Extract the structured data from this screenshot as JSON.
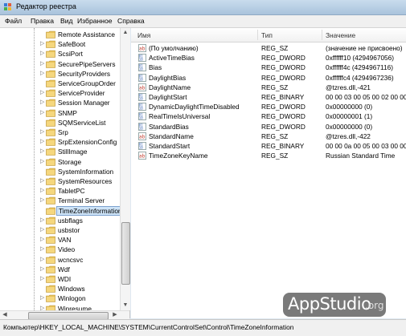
{
  "window": {
    "title": "Редактор реестра",
    "icon": "regedit-icon"
  },
  "menu": [
    "Файл",
    "Правка",
    "Вид",
    "Избранное",
    "Справка"
  ],
  "tree": {
    "items": [
      {
        "label": "Remote Assistance",
        "expandable": false,
        "selected": false
      },
      {
        "label": "SafeBoot",
        "expandable": true,
        "selected": false
      },
      {
        "label": "ScsiPort",
        "expandable": true,
        "selected": false
      },
      {
        "label": "SecurePipeServers",
        "expandable": true,
        "selected": false
      },
      {
        "label": "SecurityProviders",
        "expandable": true,
        "selected": false
      },
      {
        "label": "ServiceGroupOrder",
        "expandable": false,
        "selected": false
      },
      {
        "label": "ServiceProvider",
        "expandable": true,
        "selected": false
      },
      {
        "label": "Session Manager",
        "expandable": true,
        "selected": false
      },
      {
        "label": "SNMP",
        "expandable": true,
        "selected": false
      },
      {
        "label": "SQMServiceList",
        "expandable": false,
        "selected": false
      },
      {
        "label": "Srp",
        "expandable": true,
        "selected": false
      },
      {
        "label": "SrpExtensionConfig",
        "expandable": true,
        "selected": false
      },
      {
        "label": "StillImage",
        "expandable": true,
        "selected": false
      },
      {
        "label": "Storage",
        "expandable": true,
        "selected": false
      },
      {
        "label": "SystemInformation",
        "expandable": false,
        "selected": false
      },
      {
        "label": "SystemResources",
        "expandable": true,
        "selected": false
      },
      {
        "label": "TabletPC",
        "expandable": true,
        "selected": false
      },
      {
        "label": "Terminal Server",
        "expandable": true,
        "selected": false
      },
      {
        "label": "TimeZoneInformation",
        "expandable": false,
        "selected": true
      },
      {
        "label": "usbflags",
        "expandable": true,
        "selected": false
      },
      {
        "label": "usbstor",
        "expandable": true,
        "selected": false
      },
      {
        "label": "VAN",
        "expandable": true,
        "selected": false
      },
      {
        "label": "Video",
        "expandable": true,
        "selected": false
      },
      {
        "label": "wcncsvc",
        "expandable": true,
        "selected": false
      },
      {
        "label": "Wdf",
        "expandable": true,
        "selected": false
      },
      {
        "label": "WDI",
        "expandable": true,
        "selected": false
      },
      {
        "label": "Windows",
        "expandable": false,
        "selected": false
      },
      {
        "label": "Winlogon",
        "expandable": true,
        "selected": false
      },
      {
        "label": "Winresume",
        "expandable": true,
        "selected": false
      }
    ]
  },
  "table": {
    "columns": [
      "Имя",
      "Тип",
      "Значение"
    ],
    "rows": [
      {
        "name": "(По умолчанию)",
        "type": "REG_SZ",
        "value": "(значение не присвоено)",
        "icon": "string-value-icon"
      },
      {
        "name": "ActiveTimeBias",
        "type": "REG_DWORD",
        "value": "0xffffff10 (4294967056)",
        "icon": "binary-value-icon"
      },
      {
        "name": "Bias",
        "type": "REG_DWORD",
        "value": "0xffffff4c (4294967116)",
        "icon": "binary-value-icon"
      },
      {
        "name": "DaylightBias",
        "type": "REG_DWORD",
        "value": "0xffffffc4 (4294967236)",
        "icon": "binary-value-icon"
      },
      {
        "name": "DaylightName",
        "type": "REG_SZ",
        "value": "@tzres.dll,-421",
        "icon": "string-value-icon"
      },
      {
        "name": "DaylightStart",
        "type": "REG_BINARY",
        "value": "00 00 03 00 05 00 02 00 00 00",
        "icon": "binary-value-icon"
      },
      {
        "name": "DynamicDaylightTimeDisabled",
        "type": "REG_DWORD",
        "value": "0x00000000 (0)",
        "icon": "binary-value-icon"
      },
      {
        "name": "RealTimeIsUniversal",
        "type": "REG_DWORD",
        "value": "0x00000001 (1)",
        "icon": "binary-value-icon"
      },
      {
        "name": "StandardBias",
        "type": "REG_DWORD",
        "value": "0x00000000 (0)",
        "icon": "binary-value-icon"
      },
      {
        "name": "StandardName",
        "type": "REG_SZ",
        "value": "@tzres.dll,-422",
        "icon": "string-value-icon"
      },
      {
        "name": "StandardStart",
        "type": "REG_BINARY",
        "value": "00 00 0a 00 05 00 03 00 00 00",
        "icon": "binary-value-icon"
      },
      {
        "name": "TimeZoneKeyName",
        "type": "REG_SZ",
        "value": "Russian Standard Time",
        "icon": "string-value-icon"
      }
    ]
  },
  "status": {
    "path": "Компьютер\\HKEY_LOCAL_MACHINE\\SYSTEM\\CurrentControlSet\\Control\\TimeZoneInformation"
  },
  "watermark": {
    "main": "AppStudio",
    "suffix": ".org"
  },
  "colors": {
    "selection": "#cde3f7",
    "folder": "#e8c25a",
    "string_icon": "#c0392b",
    "binary_icon": "#2f5fb3"
  }
}
